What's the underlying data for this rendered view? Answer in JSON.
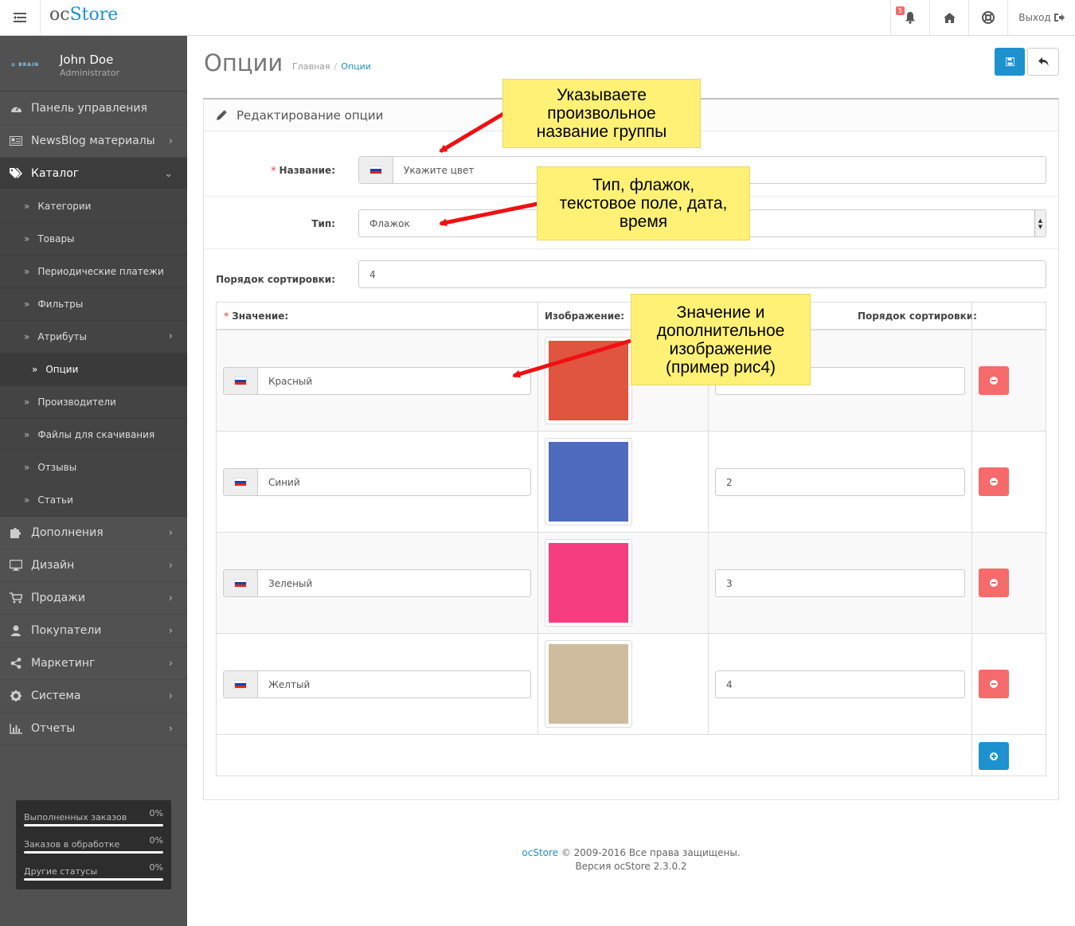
{
  "header": {
    "logo_a": "oc",
    "logo_b": "Store",
    "notif_count": "5",
    "logout": "Выход"
  },
  "user": {
    "brand": "≡ BRAIN",
    "name": "John Doe",
    "role": "Administrator"
  },
  "sidebar": {
    "top": [
      {
        "label": "Панель управления",
        "icon": "dashboard-icon"
      },
      {
        "label": "NewsBlog материалы",
        "icon": "newspaper-icon"
      },
      {
        "label": "Каталог",
        "icon": "tags-icon"
      }
    ],
    "catalog_sub": [
      {
        "label": "Категории"
      },
      {
        "label": "Товары"
      },
      {
        "label": "Периодические платежи"
      },
      {
        "label": "Фильтры"
      },
      {
        "label": "Атрибуты"
      },
      {
        "label": "Опции"
      },
      {
        "label": "Производители"
      },
      {
        "label": "Файлы для скачивания"
      },
      {
        "label": "Отзывы"
      },
      {
        "label": "Статьи"
      }
    ],
    "bottom": [
      {
        "label": "Дополнения",
        "icon": "puzzle-icon"
      },
      {
        "label": "Дизайн",
        "icon": "desktop-icon"
      },
      {
        "label": "Продажи",
        "icon": "cart-icon"
      },
      {
        "label": "Покупатели",
        "icon": "user-icon"
      },
      {
        "label": "Маркетинг",
        "icon": "share-icon"
      },
      {
        "label": "Система",
        "icon": "gear-icon"
      },
      {
        "label": "Отчеты",
        "icon": "bar-chart-icon"
      }
    ],
    "stats": [
      {
        "label": "Выполненных заказов",
        "pct": "0%"
      },
      {
        "label": "Заказов в обработке",
        "pct": "0%"
      },
      {
        "label": "Другие статусы",
        "pct": "0%"
      }
    ]
  },
  "page": {
    "title": "Опции",
    "breadcrumb": [
      "Главная",
      "Опции"
    ],
    "panel_title": "Редактирование опции"
  },
  "form": {
    "name_label": "Название:",
    "name_value": "Укажите цвет",
    "type_label": "Тип:",
    "type_value": "Флажок",
    "sort_label": "Порядок сортировки:",
    "sort_value": "4"
  },
  "values_table": {
    "headers": [
      "Значение:",
      "Изображение:",
      "Порядок сортировки:"
    ],
    "rows": [
      {
        "name": "Красный",
        "color": "#e05540",
        "sort": ""
      },
      {
        "name": "Синий",
        "color": "#4f6bbd",
        "sort": "2"
      },
      {
        "name": "Зеленый",
        "color": "#f53d7f",
        "sort": "3"
      },
      {
        "name": "Желтый",
        "color": "#cfbc9f",
        "sort": "4"
      }
    ]
  },
  "footer": {
    "link": "ocStore",
    "text": " © 2009-2016 Все права защищены.",
    "version": "Версия ocStore 2.3.0.2"
  },
  "annotations": [
    {
      "text": "Указываете\nпроизвольное\nназвание группы"
    },
    {
      "text": "Тип, флажок,\nтекстовое поле, дата,\nвремя"
    },
    {
      "text": "Значение и\nдополнительное\nизображение\n(пример рис4)"
    }
  ],
  "colors": {
    "accent": "#1e91cf",
    "danger": "#f56b6b",
    "sidebar": "#515151",
    "note": "#fff176",
    "arrow": "#ee1111"
  }
}
